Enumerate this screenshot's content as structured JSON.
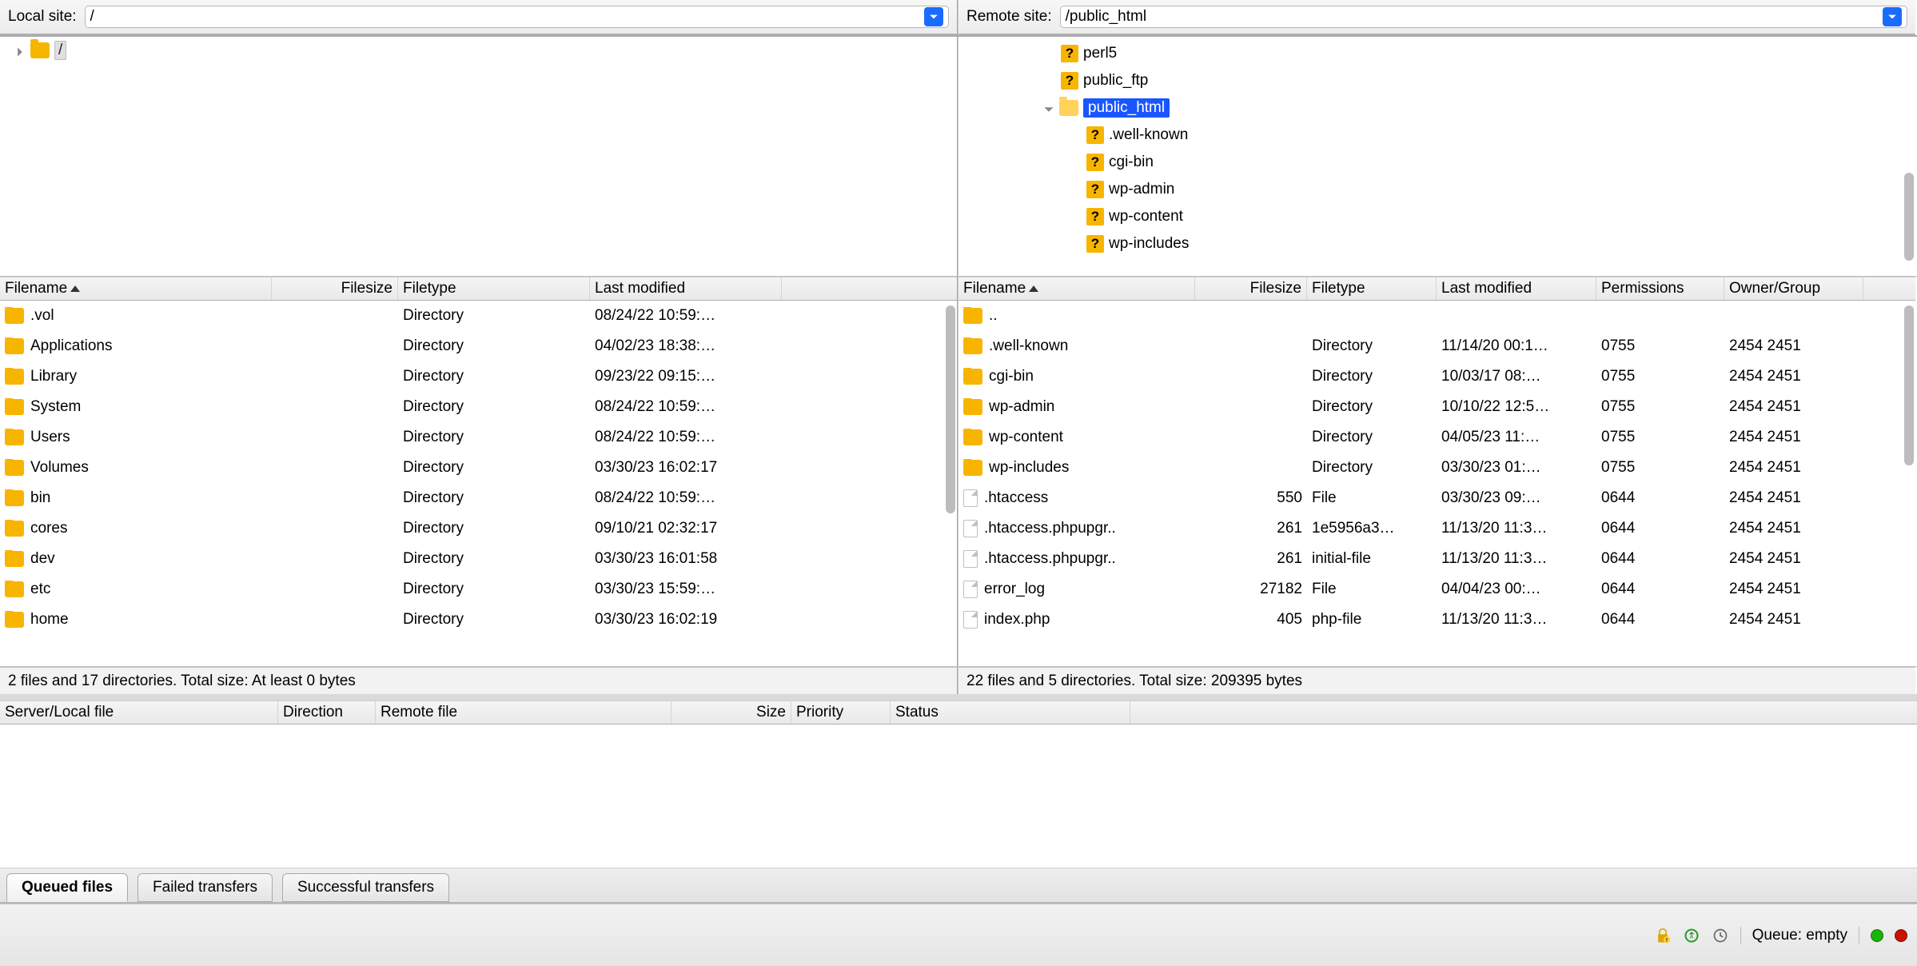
{
  "local": {
    "label": "Local site:",
    "path": "/",
    "tree_root": "/",
    "columns": [
      "Filename",
      "Filesize",
      "Filetype",
      "Last modified"
    ],
    "rows": [
      {
        "name": ".vol",
        "size": "",
        "type": "Directory",
        "mod": "08/24/22 10:59:…"
      },
      {
        "name": "Applications",
        "size": "",
        "type": "Directory",
        "mod": "04/02/23 18:38:…"
      },
      {
        "name": "Library",
        "size": "",
        "type": "Directory",
        "mod": "09/23/22 09:15:…"
      },
      {
        "name": "System",
        "size": "",
        "type": "Directory",
        "mod": "08/24/22 10:59:…"
      },
      {
        "name": "Users",
        "size": "",
        "type": "Directory",
        "mod": "08/24/22 10:59:…"
      },
      {
        "name": "Volumes",
        "size": "",
        "type": "Directory",
        "mod": "03/30/23 16:02:17"
      },
      {
        "name": "bin",
        "size": "",
        "type": "Directory",
        "mod": "08/24/22 10:59:…"
      },
      {
        "name": "cores",
        "size": "",
        "type": "Directory",
        "mod": "09/10/21 02:32:17"
      },
      {
        "name": "dev",
        "size": "",
        "type": "Directory",
        "mod": "03/30/23 16:01:58"
      },
      {
        "name": "etc",
        "size": "",
        "type": "Directory",
        "mod": "03/30/23 15:59:…"
      },
      {
        "name": "home",
        "size": "",
        "type": "Directory",
        "mod": "03/30/23 16:02:19"
      }
    ],
    "status": "2 files and 17 directories. Total size: At least 0 bytes"
  },
  "remote": {
    "label": "Remote site:",
    "path": "/public_html",
    "tree": {
      "items": [
        {
          "name": "perl5",
          "icon": "q"
        },
        {
          "name": "public_ftp",
          "icon": "q"
        },
        {
          "name": "public_html",
          "icon": "folder",
          "selected": true,
          "expanded": true,
          "children": [
            {
              "name": ".well-known",
              "icon": "q"
            },
            {
              "name": "cgi-bin",
              "icon": "q"
            },
            {
              "name": "wp-admin",
              "icon": "q"
            },
            {
              "name": "wp-content",
              "icon": "q"
            },
            {
              "name": "wp-includes",
              "icon": "q"
            }
          ]
        }
      ]
    },
    "columns": [
      "Filename",
      "Filesize",
      "Filetype",
      "Last modified",
      "Permissions",
      "Owner/Group"
    ],
    "rows": [
      {
        "icon": "folder",
        "name": "..",
        "size": "",
        "type": "",
        "mod": "",
        "perm": "",
        "owner": ""
      },
      {
        "icon": "folder",
        "name": ".well-known",
        "size": "",
        "type": "Directory",
        "mod": "11/14/20 00:1…",
        "perm": "0755",
        "owner": "2454 2451"
      },
      {
        "icon": "folder",
        "name": "cgi-bin",
        "size": "",
        "type": "Directory",
        "mod": "10/03/17 08:…",
        "perm": "0755",
        "owner": "2454 2451"
      },
      {
        "icon": "folder",
        "name": "wp-admin",
        "size": "",
        "type": "Directory",
        "mod": "10/10/22 12:5…",
        "perm": "0755",
        "owner": "2454 2451"
      },
      {
        "icon": "folder",
        "name": "wp-content",
        "size": "",
        "type": "Directory",
        "mod": "04/05/23 11:…",
        "perm": "0755",
        "owner": "2454 2451"
      },
      {
        "icon": "folder",
        "name": "wp-includes",
        "size": "",
        "type": "Directory",
        "mod": "03/30/23 01:…",
        "perm": "0755",
        "owner": "2454 2451"
      },
      {
        "icon": "file",
        "name": ".htaccess",
        "size": "550",
        "type": "File",
        "mod": "03/30/23 09:…",
        "perm": "0644",
        "owner": "2454 2451"
      },
      {
        "icon": "file",
        "name": ".htaccess.phpupgr..",
        "size": "261",
        "type": "1e5956a3…",
        "mod": "11/13/20 11:3…",
        "perm": "0644",
        "owner": "2454 2451"
      },
      {
        "icon": "file",
        "name": ".htaccess.phpupgr..",
        "size": "261",
        "type": "initial-file",
        "mod": "11/13/20 11:3…",
        "perm": "0644",
        "owner": "2454 2451"
      },
      {
        "icon": "file",
        "name": "error_log",
        "size": "27182",
        "type": "File",
        "mod": "04/04/23 00:…",
        "perm": "0644",
        "owner": "2454 2451"
      },
      {
        "icon": "file",
        "name": "index.php",
        "size": "405",
        "type": "php-file",
        "mod": "11/13/20 11:3…",
        "perm": "0644",
        "owner": "2454 2451"
      }
    ],
    "status": "22 files and 5 directories. Total size: 209395 bytes"
  },
  "queue": {
    "columns": [
      "Server/Local file",
      "Direction",
      "Remote file",
      "Size",
      "Priority",
      "Status"
    ]
  },
  "tabs": [
    "Queued files",
    "Failed transfers",
    "Successful transfers"
  ],
  "bottom": {
    "queue_label": "Queue: empty"
  }
}
